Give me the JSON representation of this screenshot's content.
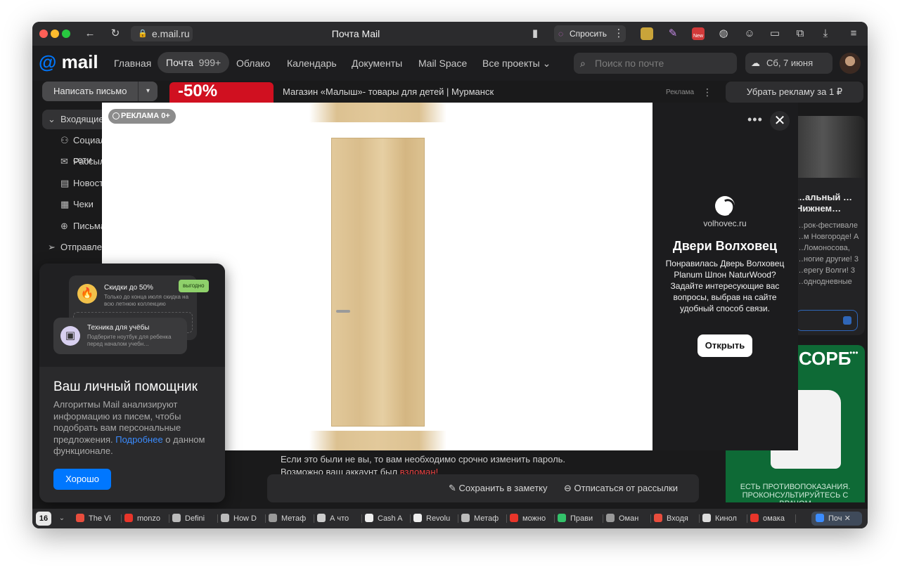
{
  "browser": {
    "url": "e.mail.ru",
    "window_title": "Почта Mail",
    "ask_button": "Спросить",
    "ext_new_badge": "New"
  },
  "header": {
    "logo_mail": "mail",
    "nav": [
      "Главная",
      "Почта",
      "Облако",
      "Календарь",
      "Документы",
      "Mail Space",
      "Все проекты"
    ],
    "mail_count": "999+",
    "search_placeholder": "Поиск по почте",
    "weather": "Сб, 7 июня"
  },
  "sidebar": {
    "compose": "Написать письмо",
    "folders": [
      "Входящие",
      "Социальные сети",
      "Рассылки",
      "Новости",
      "Чеки",
      "Письма себе",
      "Отправленные"
    ]
  },
  "top_ad": {
    "thumb_text": "-50%",
    "title": "Магазин «Малыш»- товары для детей | Мурманск",
    "label": "Реклама"
  },
  "remove_ads": "Убрать рекламу за 1 ₽",
  "right_card": {
    "title": "…альный …Нижнем…",
    "text": "…рок-фестивале …м Новгороде! А …Ломоносова, …ногие другие! 3 …ерегу Волги! 3 …однодневные"
  },
  "green_ad": {
    "brand": "СОРБ",
    "warning": "ЕСТЬ ПРОТИВОПОКАЗАНИЯ. ПРОКОНСУЛЬТИРУЙТЕСЬ С ВРАЧОМ"
  },
  "email_body": {
    "line1": "Если это были не вы, то вам необходимо срочно изменить пароль.",
    "line2_prefix": "Возможно ваш аккаунт был ",
    "line2_red": "взломан!"
  },
  "actions": {
    "save_note": "Сохранить в заметку",
    "unsubscribe": "Отписаться от рассылки"
  },
  "modal_ad": {
    "badge": "РЕКЛАМА 0+",
    "domain": "volhovec.ru",
    "heading": "Двери Волховец",
    "body": "Понравилась Дверь Волховец Planum Шпон NaturWood? Задайте интересующие вас вопросы, выбрав на сайте удобный способ связи.",
    "open_button": "Открыть"
  },
  "assistant": {
    "card1_title": "Скидки до 50%",
    "card1_sub": "Только до конца июля скидка на всю летнюю коллекцию",
    "card1_badge": "выгодно",
    "card2_title": "Техника для учёбы",
    "card2_sub": "Подберите ноутбук для ребенка перед началом учебн…",
    "title": "Ваш личный помощник",
    "text_before_link": "Алгоритмы Mail анализируют информацию из писем, чтобы подобрать вам персональные предложения. ",
    "link": "Подробнее",
    "text_after_link": " о данном функционале.",
    "ok_button": "Хорошо"
  },
  "tabbar": {
    "count": "16",
    "tabs": [
      "The Vi",
      "monzo",
      "Defini",
      "How D",
      "Метаф",
      "А что",
      "Cash A",
      "Revolu",
      "Метаф",
      "можно",
      "Прави",
      "Оман",
      "Входя",
      "Кинол",
      "омака",
      "Поч"
    ],
    "tab_colors": [
      "#e84d3d",
      "#e8352a",
      "#bbbbbb",
      "#bbbbbb",
      "#9a9a9a",
      "#cccccc",
      "#eeeeee",
      "#eeeeee",
      "#bbbbbb",
      "#e8352a",
      "#33c26a",
      "#999999",
      "#e84d3d",
      "#dddddd",
      "#e8352a",
      "#3b8cff"
    ]
  }
}
